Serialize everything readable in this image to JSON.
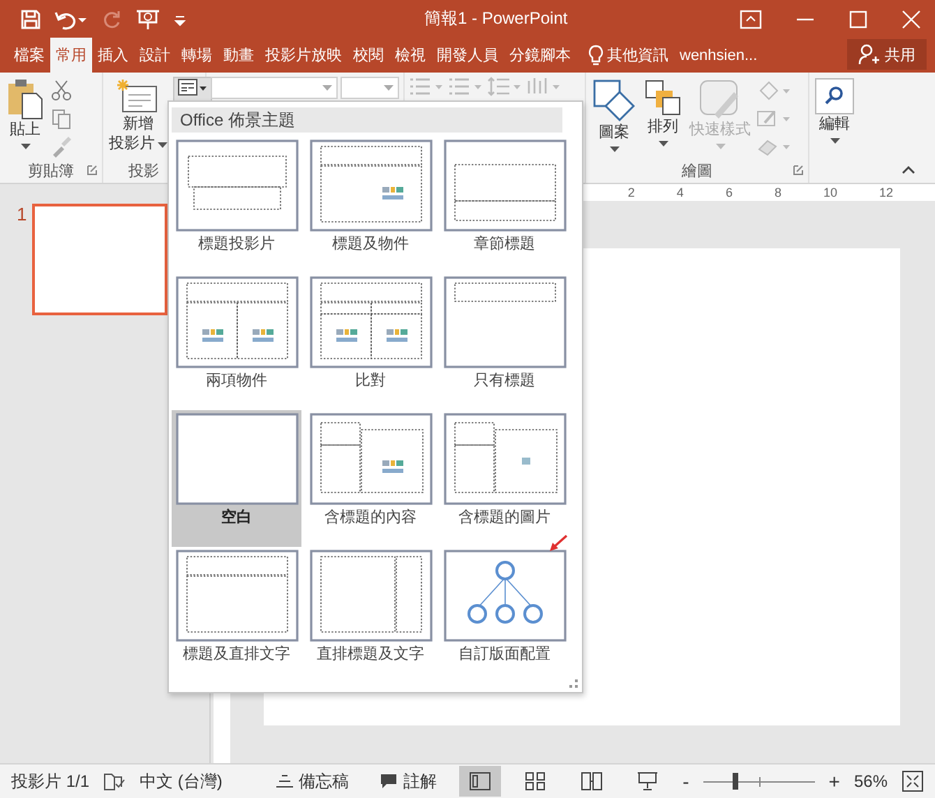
{
  "window": {
    "title": "簡報1 - PowerPoint"
  },
  "tabs": [
    {
      "label": "檔案",
      "selected": false
    },
    {
      "label": "常用",
      "selected": true
    },
    {
      "label": "插入",
      "selected": false
    },
    {
      "label": "設計",
      "selected": false
    },
    {
      "label": "轉場",
      "selected": false
    },
    {
      "label": "動畫",
      "selected": false
    },
    {
      "label": "投影片放映",
      "selected": false
    },
    {
      "label": "校閱",
      "selected": false
    },
    {
      "label": "檢視",
      "selected": false
    },
    {
      "label": "開發人員",
      "selected": false
    },
    {
      "label": "分鏡腳本",
      "selected": false
    }
  ],
  "tell_me": "其他資訊",
  "user": "wenhsien...",
  "share": "共用",
  "ribbon": {
    "paste": "貼上",
    "clipboard_group": "剪貼簿",
    "new_slide": [
      "新增",
      "投影片"
    ],
    "slides_group": "投影",
    "shapes": "圖案",
    "arrange": "排列",
    "quick_styles": {
      "label": "快速樣式",
      "disabled": true
    },
    "drawing_group": "繪圖",
    "editing": "編輯"
  },
  "layout_gallery": {
    "title": "Office 佈景主題",
    "layouts": [
      {
        "kind": "title",
        "label": "標題投影片",
        "selected": false
      },
      {
        "kind": "title-content",
        "label": "標題及物件",
        "selected": false
      },
      {
        "kind": "section",
        "label": "章節標題",
        "selected": false
      },
      {
        "kind": "two-content",
        "label": "兩項物件",
        "selected": false
      },
      {
        "kind": "comparison",
        "label": "比對",
        "selected": false
      },
      {
        "kind": "title-only",
        "label": "只有標題",
        "selected": false
      },
      {
        "kind": "blank",
        "label": "空白",
        "selected": true
      },
      {
        "kind": "content-caption",
        "label": "含標題的內容",
        "selected": false
      },
      {
        "kind": "picture-caption",
        "label": "含標題的圖片",
        "selected": false
      },
      {
        "kind": "title-vertical",
        "label": "標題及直排文字",
        "selected": false
      },
      {
        "kind": "vertical-title",
        "label": "直排標題及文字",
        "selected": false
      },
      {
        "kind": "custom",
        "label": "自訂版面配置",
        "selected": false
      }
    ]
  },
  "slides": [
    {
      "number": "1",
      "selected": true
    }
  ],
  "ruler": [
    "2",
    "4",
    "6",
    "8",
    "10",
    "12"
  ],
  "status_bar": {
    "slide": "投影片 1/1",
    "language": "中文 (台灣)",
    "notes": "備忘稿",
    "comments": "註解",
    "views": [
      {
        "kind": "normal",
        "selected": true
      },
      {
        "kind": "sorter",
        "selected": false
      },
      {
        "kind": "reading",
        "selected": false
      },
      {
        "kind": "show",
        "selected": false
      }
    ],
    "zoom_out": "-",
    "zoom_in": "+",
    "zoom": {
      "level": 0.29
    },
    "zoom_text": "56%"
  }
}
